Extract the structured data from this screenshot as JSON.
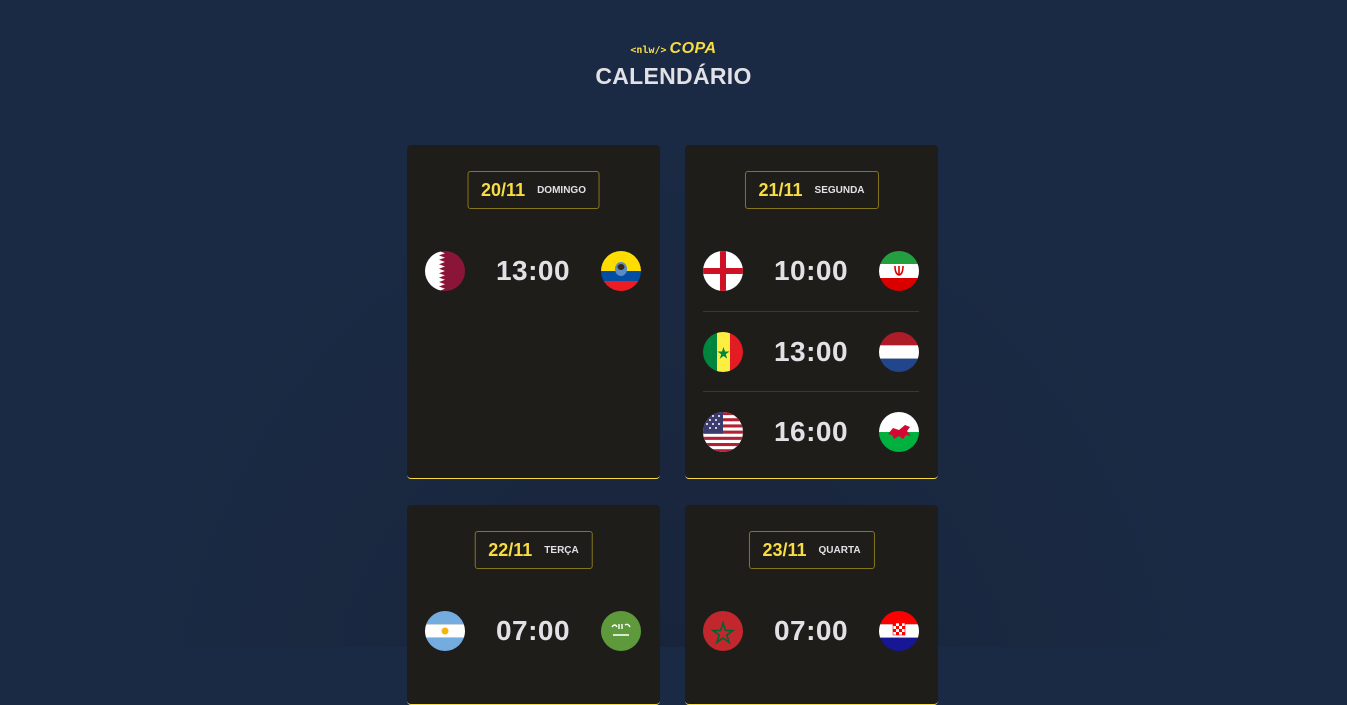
{
  "header": {
    "logo_prefix": "<nlw/>",
    "logo_name": "COPA",
    "title": "CALENDÁRIO"
  },
  "cards": [
    {
      "date": "20/11",
      "weekday": "DOMINGO",
      "games": [
        {
          "home": "qatar-flag-icon",
          "time": "13:00",
          "away": "ecuador-flag-icon"
        }
      ]
    },
    {
      "date": "21/11",
      "weekday": "SEGUNDA",
      "games": [
        {
          "home": "england-flag-icon",
          "time": "10:00",
          "away": "iran-flag-icon"
        },
        {
          "home": "senegal-flag-icon",
          "time": "13:00",
          "away": "netherlands-flag-icon"
        },
        {
          "home": "usa-flag-icon",
          "time": "16:00",
          "away": "wales-flag-icon"
        }
      ]
    },
    {
      "date": "22/11",
      "weekday": "TERÇA",
      "games": [
        {
          "home": "argentina-flag-icon",
          "time": "07:00",
          "away": "saudi-arabia-flag-icon"
        }
      ]
    },
    {
      "date": "23/11",
      "weekday": "QUARTA",
      "games": [
        {
          "home": "morocco-flag-icon",
          "time": "07:00",
          "away": "croatia-flag-icon"
        }
      ]
    }
  ],
  "colors": {
    "background": "#1b2a44",
    "card": "#1f1d1a",
    "accent": "#f7dd43",
    "text": "#e1e1e6"
  }
}
